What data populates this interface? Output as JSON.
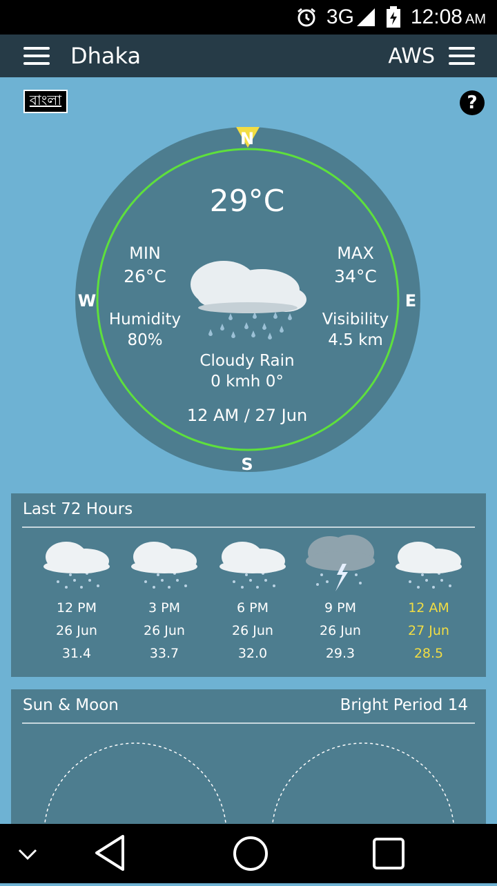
{
  "status_bar": {
    "network": "3G",
    "time": "12:08",
    "ampm": "AM"
  },
  "toolbar": {
    "city": "Dhaka",
    "source": "AWS"
  },
  "language_button": "বাংলা",
  "help_label": "?",
  "current": {
    "temperature": "29°C",
    "min_label": "MIN",
    "min_value": "26°C",
    "max_label": "MAX",
    "max_value": "34°C",
    "humidity_label": "Humidity",
    "humidity_value": "80%",
    "visibility_label": "Visibility",
    "visibility_value": "4.5 km",
    "condition": "Cloudy Rain",
    "wind": "0 kmh 0°",
    "timestamp": "12 AM / 27 Jun",
    "compass": {
      "n": "N",
      "s": "S",
      "e": "E",
      "w": "W"
    },
    "wind_direction_deg": 0
  },
  "last72": {
    "title": "Last 72 Hours",
    "items": [
      {
        "time": "12 PM",
        "date": "26 Jun",
        "temp": "31.4",
        "icon": "cloud-rain-icon",
        "current": false
      },
      {
        "time": "3 PM",
        "date": "26 Jun",
        "temp": "33.7",
        "icon": "cloud-rain-icon",
        "current": false
      },
      {
        "time": "6 PM",
        "date": "26 Jun",
        "temp": "32.0",
        "icon": "cloud-rain-icon",
        "current": false
      },
      {
        "time": "9 PM",
        "date": "26 Jun",
        "temp": "29.3",
        "icon": "thunderstorm-icon",
        "current": false
      },
      {
        "time": "12 AM",
        "date": "27 Jun",
        "temp": "28.5",
        "icon": "cloud-rain-icon",
        "current": true
      }
    ]
  },
  "sun_moon": {
    "title": "Sun & Moon",
    "bright_period": "Bright Period 14"
  },
  "colors": {
    "background": "#6eb2d3",
    "toolbar": "#263b47",
    "dial": "#4d7d8f",
    "ring": "#5ee03c",
    "highlight": "#f2dd43"
  }
}
